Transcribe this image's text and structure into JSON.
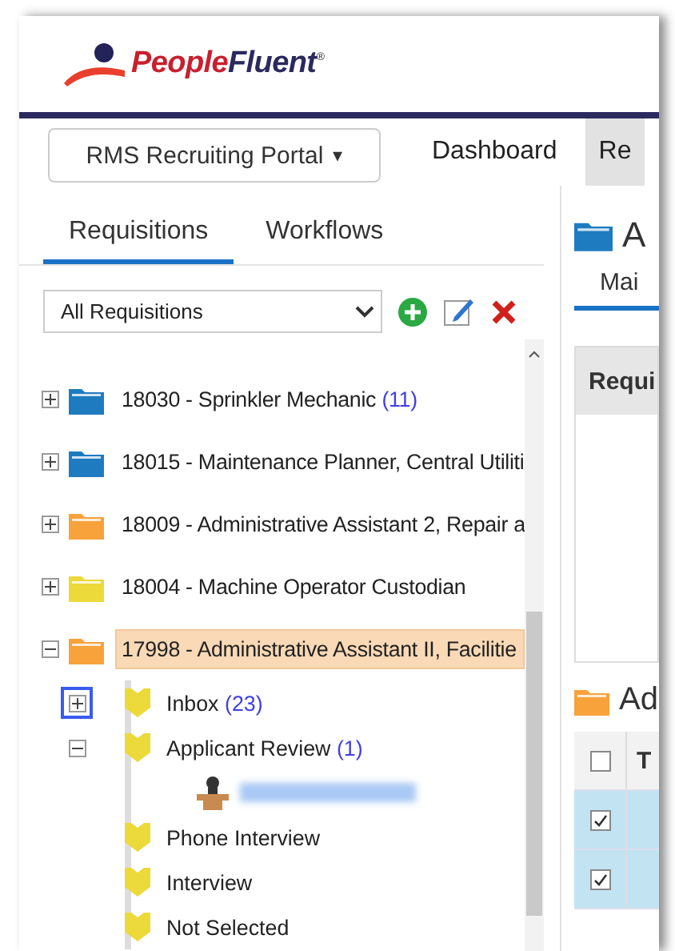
{
  "logo": {
    "part_1": "People",
    "part_2": "Fluent",
    "mark": "®"
  },
  "nav": {
    "portal": {
      "label": "RMS Recruiting Portal",
      "caret": "▾"
    },
    "items": [
      {
        "label": "Dashboard",
        "selected": false
      },
      {
        "label": "Re",
        "selected": true
      }
    ]
  },
  "left_tabs": [
    {
      "label": "Requisitions",
      "selected": true
    },
    {
      "label": "Workflows",
      "selected": false
    }
  ],
  "filter": {
    "value": "All Requisitions"
  },
  "requisitions": [
    {
      "title": "18030 - Sprinkler Mechanic",
      "count": "(11)",
      "color": "#1f7bc0",
      "expanded": false,
      "selected": false
    },
    {
      "title": "18015 - Maintenance Planner, Central Utiliti",
      "color": "#1f7bc0",
      "expanded": false,
      "selected": false
    },
    {
      "title": "18009 - Administrative Assistant 2, Repair a",
      "color": "#f7a23b",
      "expanded": false,
      "selected": false
    },
    {
      "title": "18004 - Machine Operator Custodian",
      "color": "#ecd93a",
      "expanded": false,
      "selected": false
    },
    {
      "title": "17998 - Administrative Assistant II, Facilitie",
      "color": "#f7a23b",
      "expanded": true,
      "selected": true,
      "children": [
        {
          "label": "Inbox",
          "count": "(23)",
          "kind": "toggle",
          "expanded": false,
          "focused": true
        },
        {
          "label": "Applicant Review",
          "count": "(1)",
          "kind": "toggle",
          "expanded": true,
          "focused": false,
          "children": [
            {
              "kind": "redacted"
            }
          ]
        },
        {
          "label": "Phone Interview",
          "kind": "plain"
        },
        {
          "label": "Interview",
          "kind": "plain"
        },
        {
          "label": "Not Selected",
          "kind": "plain"
        }
      ]
    }
  ],
  "right": {
    "title": "A",
    "tab": "Mai",
    "box_header": "Requi",
    "section_title": "Ad",
    "table": {
      "header": "T",
      "all_checked": false,
      "rows": [
        {
          "checked": true,
          "selected": true
        },
        {
          "checked": true,
          "selected": true
        }
      ]
    }
  }
}
